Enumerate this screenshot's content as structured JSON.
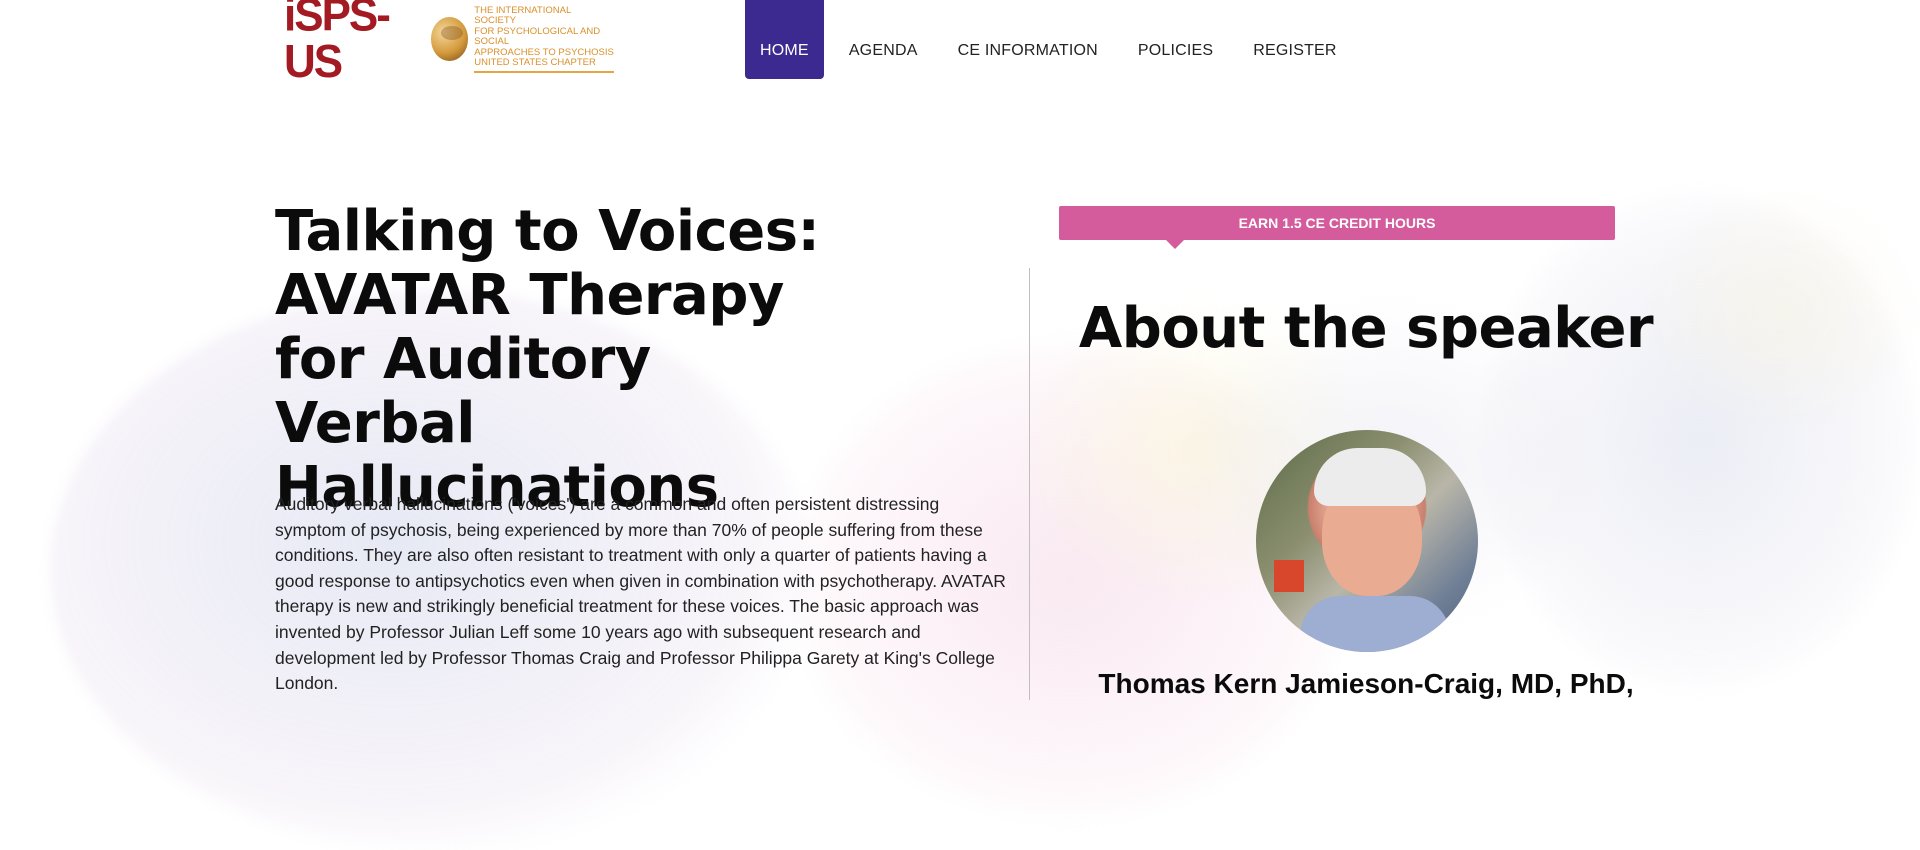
{
  "logo": {
    "mark": "iSPS-US",
    "lines": [
      "THE INTERNATIONAL SOCIETY",
      "FOR PSYCHOLOGICAL AND SOCIAL",
      "APPROACHES TO PSYCHOSIS",
      "UNITED STATES CHAPTER"
    ],
    "colors": {
      "mark": "#a31a22",
      "text": "#d9902a"
    }
  },
  "nav": {
    "items": [
      {
        "label": "HOME",
        "active": true
      },
      {
        "label": "AGENDA",
        "active": false
      },
      {
        "label": "CE INFORMATION",
        "active": false
      },
      {
        "label": "POLICIES",
        "active": false
      },
      {
        "label": "REGISTER",
        "active": false
      }
    ],
    "active_color": "#3d2a91"
  },
  "main": {
    "title": "Talking to Voices: AVATAR Therapy for Auditory Verbal Hallucinations",
    "description": "Auditory verbal hallucinations ('voices') are a common and often persistent distressing symptom of psychosis, being experienced by more than 70% of people suffering from these conditions. They are also often resistant to treatment with only a quarter of patients having a good response to antipsychotics even when given in combination with psychotherapy. AVATAR therapy is new and strikingly beneficial treatment for these voices. The basic approach was invented by Professor Julian Leff some 10 years ago with subsequent research and development led by Professor Thomas Craig and Professor Philippa Garety at King's College London."
  },
  "sidebar": {
    "ce_banner": "EARN 1.5 CE CREDIT HOURS",
    "ce_banner_color": "#d45c9c",
    "about_title": "About the speaker",
    "speaker_name": "Thomas Kern Jamieson-Craig, MD, PhD,"
  }
}
